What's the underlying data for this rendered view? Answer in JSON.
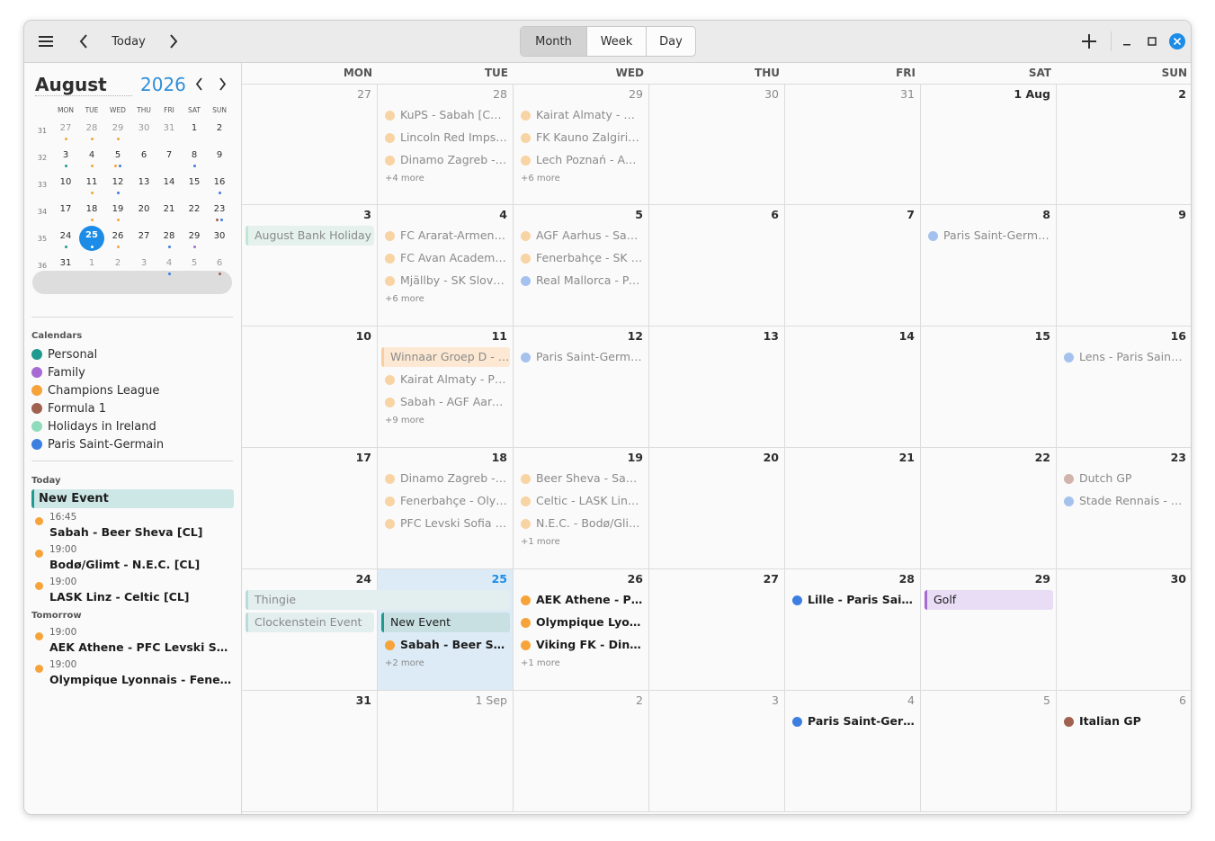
{
  "header": {
    "today_label": "Today",
    "views": [
      {
        "label": "Month",
        "active": true
      },
      {
        "label": "Week",
        "active": false
      },
      {
        "label": "Day",
        "active": false
      }
    ]
  },
  "colors": {
    "accent": "#1c8ce6",
    "personal": "#1e9a8e",
    "family": "#a66ad3",
    "champions_league": "#f6a43a",
    "formula1": "#a0614f",
    "holidays_ireland": "#8fdcbc",
    "psg": "#3d7fe0"
  },
  "mini_calendar": {
    "month": "August",
    "year": "2026",
    "dow": [
      "MON",
      "TUE",
      "WED",
      "THU",
      "FRI",
      "SAT",
      "SUN"
    ],
    "weeks": [
      {
        "wk": "31",
        "days": [
          [
            "27",
            1,
            [
              "o"
            ]
          ],
          [
            "28",
            1,
            [
              "o"
            ]
          ],
          [
            "29",
            1,
            [
              "o"
            ]
          ],
          [
            "30",
            1,
            []
          ],
          [
            "31",
            1,
            []
          ],
          [
            "1",
            0,
            []
          ],
          [
            "2",
            0,
            []
          ]
        ]
      },
      {
        "wk": "32",
        "days": [
          [
            "3",
            0,
            [
              "t"
            ]
          ],
          [
            "4",
            0,
            [
              "o"
            ]
          ],
          [
            "5",
            0,
            [
              "o",
              "b"
            ]
          ],
          [
            "6",
            0,
            []
          ],
          [
            "7",
            0,
            []
          ],
          [
            "8",
            0,
            [
              "b"
            ]
          ],
          [
            "9",
            0,
            []
          ]
        ]
      },
      {
        "wk": "33",
        "days": [
          [
            "10",
            0,
            []
          ],
          [
            "11",
            0,
            [
              "o"
            ]
          ],
          [
            "12",
            0,
            [
              "b"
            ]
          ],
          [
            "13",
            0,
            []
          ],
          [
            "14",
            0,
            []
          ],
          [
            "15",
            0,
            []
          ],
          [
            "16",
            0,
            [
              "b"
            ]
          ]
        ]
      },
      {
        "wk": "34",
        "days": [
          [
            "17",
            0,
            []
          ],
          [
            "18",
            0,
            [
              "o"
            ]
          ],
          [
            "19",
            0,
            [
              "o"
            ]
          ],
          [
            "20",
            0,
            []
          ],
          [
            "21",
            0,
            []
          ],
          [
            "22",
            0,
            []
          ],
          [
            "23",
            0,
            [
              "r",
              "b"
            ]
          ]
        ]
      },
      {
        "wk": "35",
        "days": [
          [
            "24",
            0,
            [
              "t"
            ]
          ],
          [
            "25",
            0,
            [
              "o"
            ]
          ],
          [
            "26",
            0,
            [
              "o"
            ]
          ],
          [
            "27",
            0,
            []
          ],
          [
            "28",
            0,
            [
              "b"
            ]
          ],
          [
            "29",
            0,
            [
              "p"
            ]
          ],
          [
            "30",
            0,
            []
          ]
        ]
      },
      {
        "wk": "36",
        "days": [
          [
            "31",
            0,
            []
          ],
          [
            "1",
            1,
            []
          ],
          [
            "2",
            1,
            []
          ],
          [
            "3",
            1,
            []
          ],
          [
            "4",
            1,
            [
              "b"
            ]
          ],
          [
            "5",
            1,
            []
          ],
          [
            "6",
            1,
            [
              "r"
            ]
          ]
        ]
      }
    ]
  },
  "calendars": {
    "label": "Calendars",
    "items": [
      {
        "name": "Personal",
        "color": "#1e9a8e"
      },
      {
        "name": "Family",
        "color": "#a66ad3"
      },
      {
        "name": "Champions League",
        "color": "#f6a43a"
      },
      {
        "name": "Formula 1",
        "color": "#a0614f"
      },
      {
        "name": "Holidays in Ireland",
        "color": "#8fdcbc"
      },
      {
        "name": "Paris Saint-Germain",
        "color": "#3d7fe0"
      }
    ]
  },
  "agenda": {
    "today_label": "Today",
    "today_allday": "New Event",
    "today_events": [
      {
        "time": "16:45",
        "title": "Sabah - Beer Sheva [CL]"
      },
      {
        "time": "19:00",
        "title": "Bodø/Glimt - N.E.C. [CL]"
      },
      {
        "time": "19:00",
        "title": "LASK Linz - Celtic [CL]"
      }
    ],
    "tomorrow_label": "Tomorrow",
    "tomorrow_events": [
      {
        "time": "19:00",
        "title": "AEK Athene - PFC Levski Sofia [CL]"
      },
      {
        "time": "19:00",
        "title": "Olympique Lyonnais - Fenerbahçe [CL]"
      }
    ]
  },
  "month_view": {
    "dow": [
      "MON",
      "TUE",
      "WED",
      "THU",
      "FRI",
      "SAT",
      "SUN"
    ],
    "weeks": [
      [
        {
          "n": "27",
          "dim": true
        },
        {
          "n": "28",
          "dim": true,
          "events": [
            [
              "KuPS - Sabah [CL] (…",
              "o",
              1
            ],
            [
              "Lincoln Red Imps - …",
              "o",
              1
            ],
            [
              "Dinamo Zagreb - F…",
              "o",
              1
            ]
          ],
          "more": "+4 more"
        },
        {
          "n": "29",
          "dim": true,
          "events": [
            [
              "Kairat Almaty - Om…",
              "o",
              1
            ],
            [
              "FK Kauno Zalgiris -…",
              "o",
              1
            ],
            [
              "Lech Poznań - AGF …",
              "o",
              1
            ]
          ],
          "more": "+6 more"
        },
        {
          "n": "30",
          "dim": true
        },
        {
          "n": "31",
          "dim": true
        },
        {
          "n": "1 Aug"
        },
        {
          "n": "2"
        }
      ],
      [
        {
          "n": "3"
        },
        {
          "n": "4",
          "events": [
            [
              "FC Ararat-Armenia…",
              "o",
              1
            ],
            [
              "FC Avan Academy -…",
              "o",
              1
            ],
            [
              "Mjällby - SK Slovan…",
              "o",
              1
            ]
          ],
          "more": "+6 more"
        },
        {
          "n": "5",
          "events": [
            [
              "AGF Aarhus - Saba…",
              "o",
              1
            ],
            [
              "Fenerbahçe - SK St…",
              "o",
              1
            ],
            [
              "Real Mallorca - Pa…",
              "b",
              1
            ]
          ]
        },
        {
          "n": "6"
        },
        {
          "n": "7"
        },
        {
          "n": "8",
          "events": [
            [
              "Paris Saint-Germai…",
              "b",
              1
            ]
          ]
        },
        {
          "n": "9"
        }
      ],
      [
        {
          "n": "10"
        },
        {
          "n": "11",
          "events": [
            [
              "",
              "",
              0
            ],
            [
              "Kairat Almaty - PF…",
              "o",
              1
            ],
            [
              "Sabah - AGF Aarhu…",
              "o",
              1
            ]
          ],
          "more": "+9 more"
        },
        {
          "n": "12",
          "events": [
            [
              "Paris Saint-Germai…",
              "b",
              1
            ]
          ]
        },
        {
          "n": "13"
        },
        {
          "n": "14"
        },
        {
          "n": "15"
        },
        {
          "n": "16",
          "events": [
            [
              "Lens - Paris Saint-…",
              "b",
              1
            ]
          ]
        }
      ],
      [
        {
          "n": "17"
        },
        {
          "n": "18",
          "events": [
            [
              "Dinamo Zagreb - Vi…",
              "o",
              1
            ],
            [
              "Fenerbahçe - Olym…",
              "o",
              1
            ],
            [
              "PFC Levski Sofia - …",
              "o",
              1
            ]
          ]
        },
        {
          "n": "19",
          "events": [
            [
              "Beer Sheva - Saba…",
              "o",
              1
            ],
            [
              "Celtic - LASK Linz [...",
              "o",
              1
            ],
            [
              "N.E.C. - Bodø/Glimt…",
              "o",
              1
            ]
          ],
          "more": "+1 more"
        },
        {
          "n": "20"
        },
        {
          "n": "21"
        },
        {
          "n": "22"
        },
        {
          "n": "23",
          "events": [
            [
              "Dutch GP",
              "r",
              1
            ],
            [
              "Stade Rennais - Pa…",
              "b",
              1
            ]
          ]
        }
      ],
      [
        {
          "n": "24"
        },
        {
          "n": "25",
          "today": true,
          "events": [
            [
              "",
              "",
              0
            ],
            [
              "",
              "",
              0
            ],
            [
              "Sabah - Beer Shev…",
              "o",
              2
            ]
          ],
          "more": "+2 more"
        },
        {
          "n": "26",
          "events": [
            [
              "AEK Athene - PFC …",
              "o",
              2
            ],
            [
              "Olympique Lyonnai…",
              "o",
              2
            ],
            [
              "Viking FK - Dinamo…",
              "o",
              2
            ]
          ],
          "more": "+1 more"
        },
        {
          "n": "27"
        },
        {
          "n": "28",
          "events": [
            [
              "Lille - Paris Saint-G…",
              "b",
              2
            ]
          ]
        },
        {
          "n": "29"
        },
        {
          "n": "30"
        }
      ],
      [
        {
          "n": "31"
        },
        {
          "n": "1 Sep",
          "dim": true
        },
        {
          "n": "2",
          "dim": true
        },
        {
          "n": "3",
          "dim": true
        },
        {
          "n": "4",
          "dim": true,
          "events": [
            [
              "Paris Saint-Germai…",
              "b",
              2
            ]
          ]
        },
        {
          "n": "5",
          "dim": true
        },
        {
          "n": "6",
          "dim": true,
          "events": [
            [
              "Italian GP",
              "r",
              2
            ]
          ]
        }
      ]
    ],
    "bars": {
      "bank_holiday": "August Bank Holiday",
      "winnaar": "Winnaar Groep D - W…",
      "thingie": "Thingie",
      "clockenstein": "Clockenstein Event",
      "new_event": "New Event",
      "golf": "Golf"
    }
  }
}
